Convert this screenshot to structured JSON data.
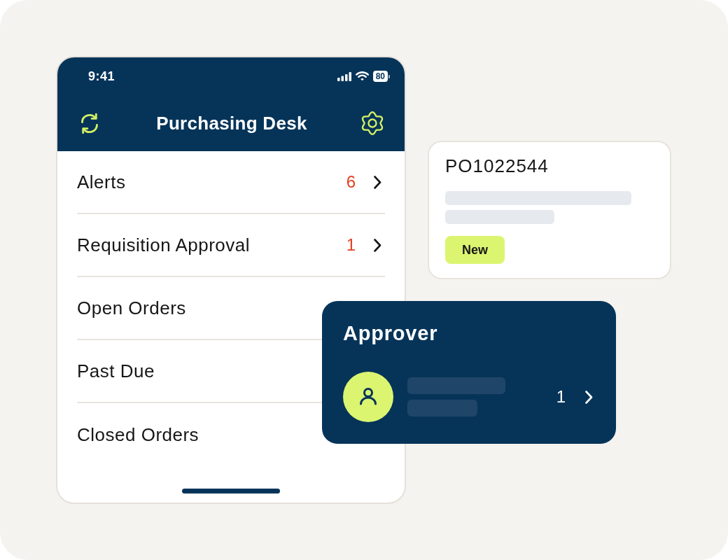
{
  "phone": {
    "status_bar": {
      "time": "9:41",
      "battery": "80"
    },
    "title": "Purchasing Desk",
    "menu": [
      {
        "label": "Alerts",
        "count": "6"
      },
      {
        "label": "Requisition Approval",
        "count": "1"
      },
      {
        "label": "Open Orders"
      },
      {
        "label": "Past Due"
      },
      {
        "label": "Closed Orders"
      }
    ]
  },
  "order_card": {
    "number": "PO1022544",
    "status": "New"
  },
  "approver_card": {
    "title": "Approver",
    "count": "1"
  }
}
